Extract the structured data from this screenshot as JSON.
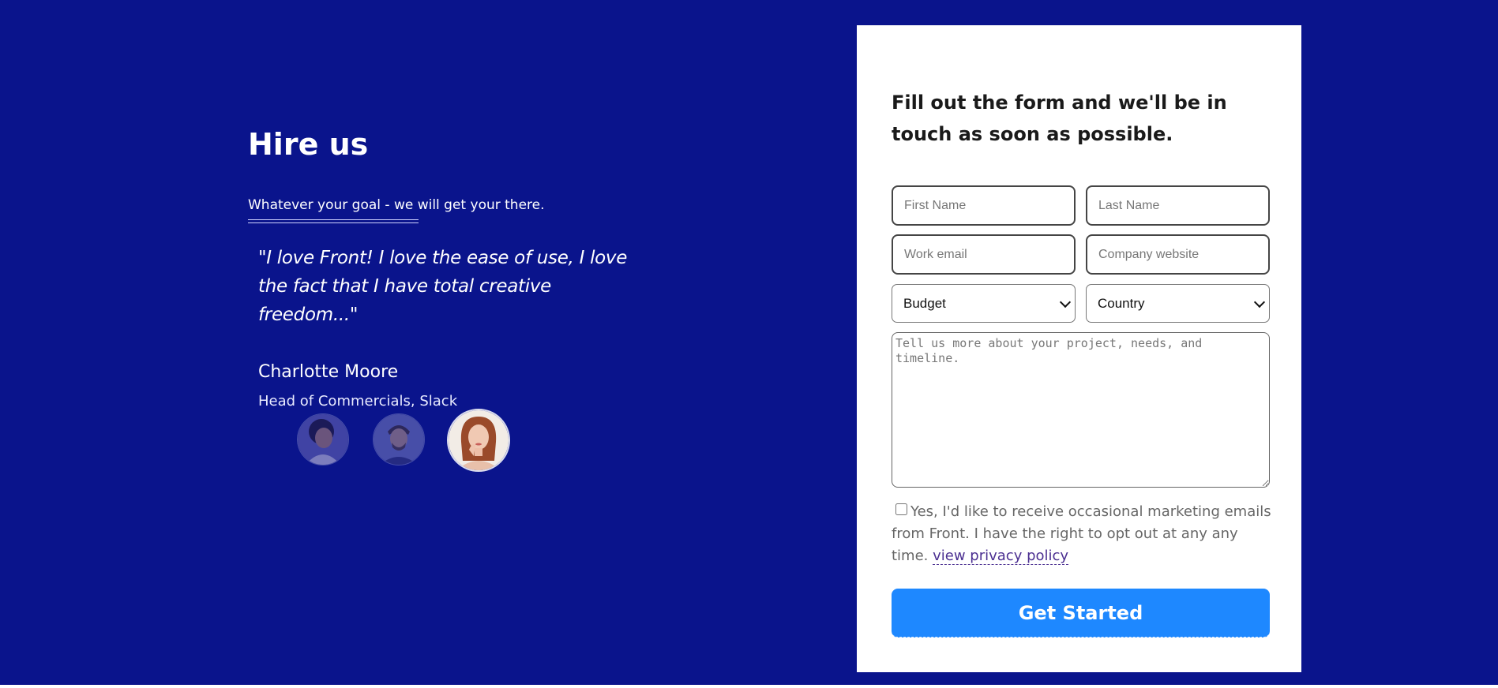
{
  "left": {
    "title": "Hire us",
    "subtitle": "Whatever your goal - we will get your there.",
    "quote": "\"I love Front! I love the ease of use, I love the fact that I have total creative freedom...\"",
    "author": "Charlotte Moore",
    "role": "Head of Commercials, Slack",
    "avatars": [
      "avatar-1",
      "avatar-2",
      "avatar-3"
    ]
  },
  "form": {
    "title": "Fill out the form and we'll be in touch as soon as possible.",
    "first_name_placeholder": "First Name",
    "last_name_placeholder": "Last Name",
    "work_email_placeholder": "Work email",
    "company_website_placeholder": "Company website",
    "budget_selected": "Budget",
    "country_selected": "Country",
    "message_placeholder": "Tell us more about your project, needs, and timeline.",
    "consent_text": "Yes, I'd like to receive occasional marketing emails from Front. I have the right to opt out at any any time.",
    "privacy_link": "view privacy policy",
    "submit_label": "Get Started"
  },
  "colors": {
    "background": "#0a148c",
    "button": "#1e88ff",
    "card": "#ffffff"
  }
}
